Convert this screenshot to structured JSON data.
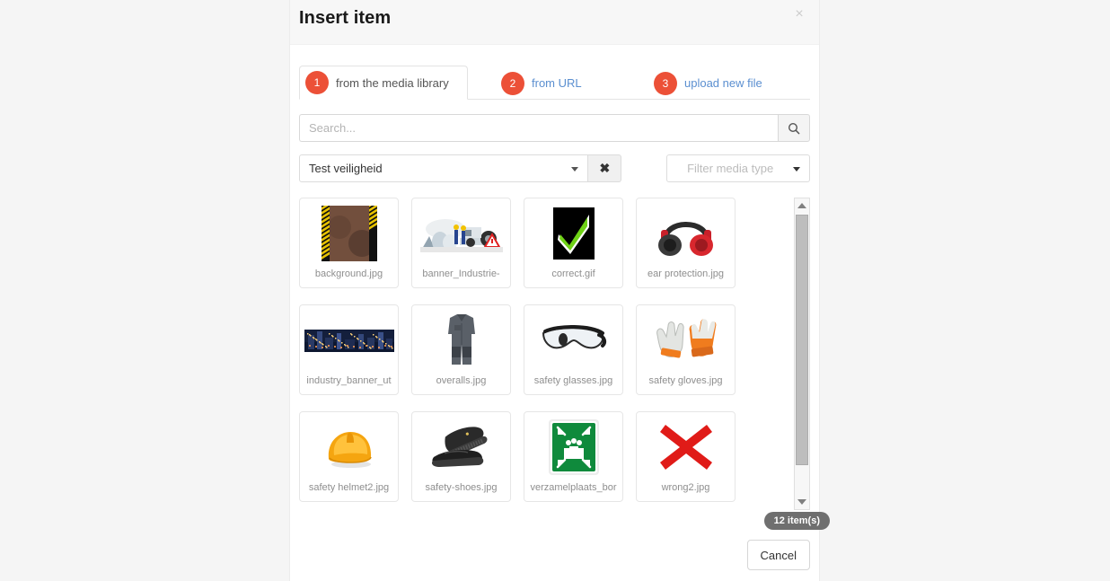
{
  "dialog": {
    "title": "Insert item",
    "close_label": "×"
  },
  "tabs": [
    {
      "num": "1",
      "label": "from the media library",
      "active": true
    },
    {
      "num": "2",
      "label": "from URL",
      "active": false
    },
    {
      "num": "3",
      "label": "upload new file",
      "active": false
    }
  ],
  "search": {
    "placeholder": "Search...",
    "value": "",
    "button_icon": "search-icon"
  },
  "filters": {
    "category_value": "Test veiligheid",
    "clear_label": "✖",
    "media_type_placeholder": "Filter media type"
  },
  "gallery": {
    "items": [
      {
        "label": "background.jpg",
        "kind": "background"
      },
      {
        "label": "banner_Industrie-",
        "kind": "banner-industry"
      },
      {
        "label": "correct.gif",
        "kind": "correct-check"
      },
      {
        "label": "ear protection.jpg",
        "kind": "ear-protection"
      },
      {
        "label": "industry_banner_ut",
        "kind": "industry-banner"
      },
      {
        "label": "overalls.jpg",
        "kind": "overalls"
      },
      {
        "label": "safety glasses.jpg",
        "kind": "safety-glasses"
      },
      {
        "label": "safety gloves.jpg",
        "kind": "safety-gloves"
      },
      {
        "label": "safety helmet2.jpg",
        "kind": "safety-helmet"
      },
      {
        "label": "safety-shoes.jpg",
        "kind": "safety-shoes"
      },
      {
        "label": "verzamelplaats_bor",
        "kind": "assembly-point-sign"
      },
      {
        "label": "wrong2.jpg",
        "kind": "wrong-cross"
      }
    ],
    "count_badge": "12 item(s)"
  },
  "footer": {
    "cancel_label": "Cancel"
  },
  "colors": {
    "accent": "#ec5037",
    "link": "#5b8fd0",
    "badge_bg": "#6f6f6f"
  }
}
